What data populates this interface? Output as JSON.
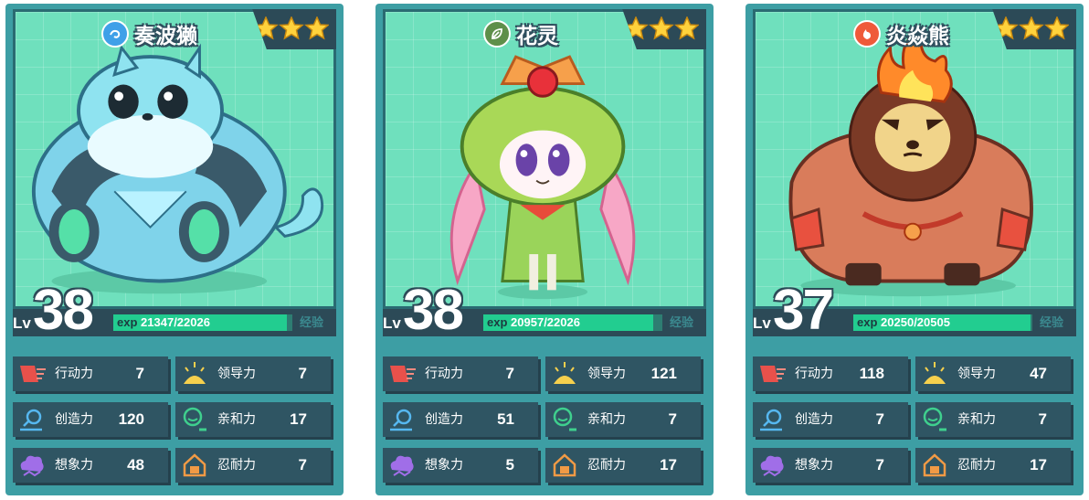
{
  "labels": {
    "lv": "Lv",
    "exp": "exp",
    "exp_link": "经验"
  },
  "stat_labels": {
    "action": "行动力",
    "leadership": "领导力",
    "creativity": "创造力",
    "affinity": "亲和力",
    "imagination": "想象力",
    "endurance": "忍耐力"
  },
  "cards": [
    {
      "name": "奏波獭",
      "element_icon": "water-icon",
      "element_color": "#3fa0e8",
      "stars": 3,
      "level": "38",
      "exp_current": "21347",
      "exp_max": "/22026",
      "exp_fraction": 0.969,
      "stats": {
        "action": "7",
        "leadership": "7",
        "creativity": "120",
        "affinity": "17",
        "imagination": "48",
        "endurance": "7"
      }
    },
    {
      "name": "花灵",
      "element_icon": "leaf-icon",
      "element_color": "#5e8f4a",
      "stars": 3,
      "level": "38",
      "exp_current": "20957",
      "exp_max": "/22026",
      "exp_fraction": 0.951,
      "stats": {
        "action": "7",
        "leadership": "121",
        "creativity": "51",
        "affinity": "7",
        "imagination": "5",
        "endurance": "17"
      }
    },
    {
      "name": "炎焱熊",
      "element_icon": "fire-icon",
      "element_color": "#ef5a3a",
      "stars": 3,
      "level": "37",
      "exp_current": "20250",
      "exp_max": "/20505",
      "exp_fraction": 0.988,
      "stats": {
        "action": "118",
        "leadership": "47",
        "creativity": "7",
        "affinity": "7",
        "imagination": "7",
        "endurance": "17"
      }
    }
  ]
}
